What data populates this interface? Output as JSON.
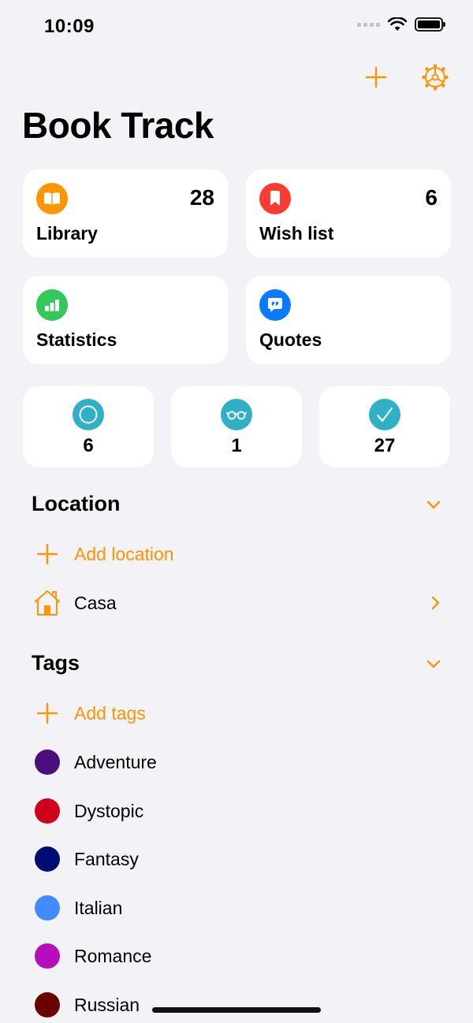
{
  "status_bar": {
    "time": "10:09"
  },
  "header": {
    "title": "Book Track"
  },
  "colors": {
    "accent": "#ff9500",
    "library": "#ff9500",
    "wishlist": "#ff3b30",
    "statistics": "#34c759",
    "quotes": "#0a7aff",
    "status": "#30b0c7"
  },
  "cards": {
    "library": {
      "label": "Library",
      "count": "28",
      "icon": "book-icon"
    },
    "wishlist": {
      "label": "Wish list",
      "count": "6",
      "icon": "bookmark-icon"
    },
    "statistics": {
      "label": "Statistics",
      "icon": "chart-icon"
    },
    "quotes": {
      "label": "Quotes",
      "icon": "quote-icon"
    }
  },
  "status_counts": {
    "unread": {
      "count": "6",
      "icon": "circle-icon"
    },
    "reading": {
      "count": "1",
      "icon": "glasses-icon"
    },
    "read": {
      "count": "27",
      "icon": "checkmark-icon"
    }
  },
  "location": {
    "title": "Location",
    "add_label": "Add location",
    "items": [
      {
        "label": "Casa",
        "icon": "house-icon"
      }
    ]
  },
  "tags": {
    "title": "Tags",
    "add_label": "Add tags",
    "items": [
      {
        "label": "Adventure",
        "color": "#4a0f7a"
      },
      {
        "label": "Dystopic",
        "color": "#d0021b"
      },
      {
        "label": "Fantasy",
        "color": "#000c70"
      },
      {
        "label": "Italian",
        "color": "#3f8cff"
      },
      {
        "label": "Romance",
        "color": "#b60dbd"
      },
      {
        "label": "Russian",
        "color": "#6a0000"
      }
    ]
  }
}
